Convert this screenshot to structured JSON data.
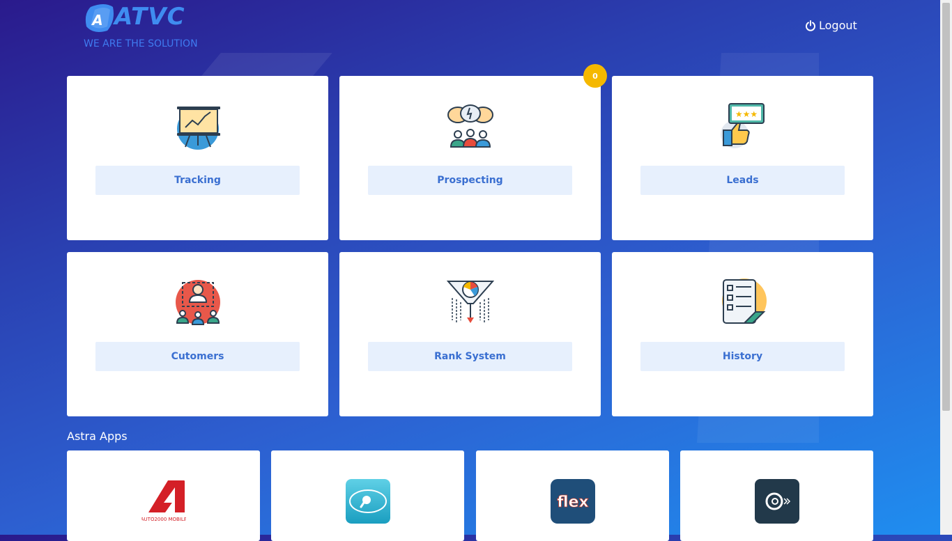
{
  "header": {
    "logo_letter": "A",
    "logo_text": "ATVC",
    "tagline": "WE ARE THE SOLUTION",
    "logout_label": "Logout"
  },
  "menu": {
    "tracking": "Tracking",
    "prospecting": "Prospecting",
    "prospecting_badge": "0",
    "leads": "Leads",
    "customers": "Cutomers",
    "rank_system": "Rank System",
    "history": "History"
  },
  "apps_section": {
    "title": "Astra Apps",
    "auto2000_caption": "AUTO2000 MOBILE",
    "flex_label": "flex"
  },
  "colors": {
    "accent": "#3a6fd1",
    "button_bg": "#e7f0fd",
    "badge": "#f5b800"
  }
}
